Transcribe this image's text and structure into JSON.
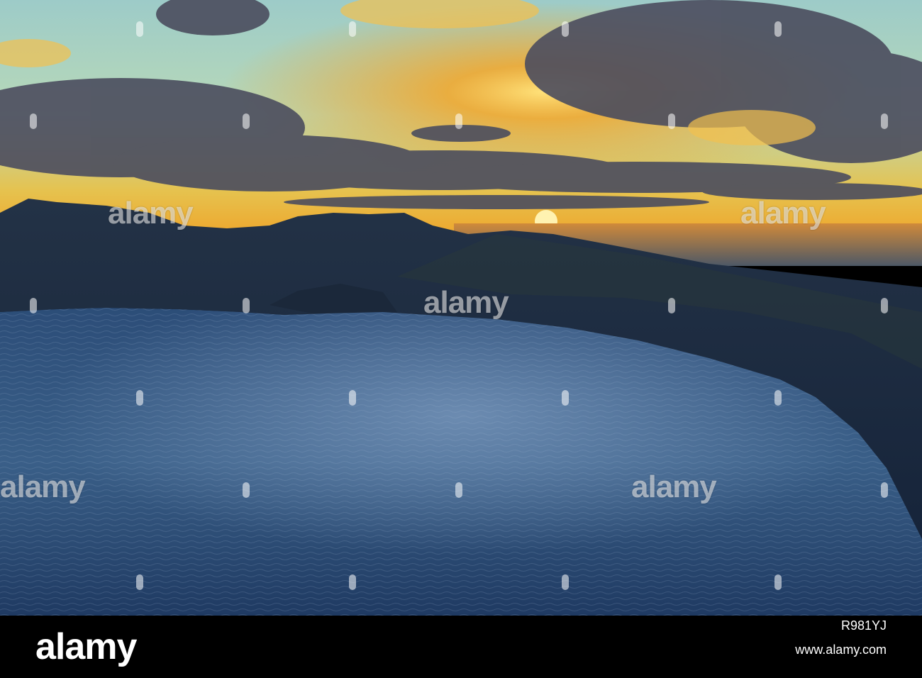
{
  "photo": {
    "subject": "Aerial view of a caldera lake at sunset with cloudy sky",
    "colors": {
      "sky_teal": "#8fc6c0",
      "sky_gold": "#f2c44a",
      "sun_orange": "#f7a321",
      "cloud_dark": "#4a4a5a",
      "mountain": "#1c2a3e",
      "lake": "#2a4a72",
      "lake_highlight": "#6d8fb0"
    }
  },
  "watermark": {
    "text": "alamy"
  },
  "footer": {
    "logo": "alamy",
    "image_id": "R981YJ",
    "url": "www.alamy.com"
  }
}
